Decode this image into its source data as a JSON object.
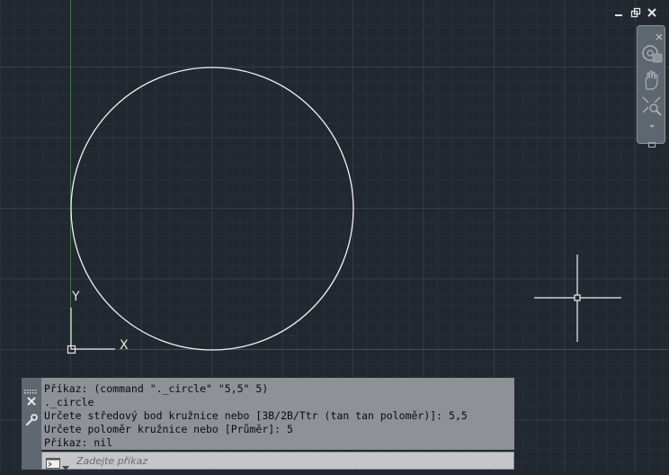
{
  "colors": {
    "background": "#212830",
    "grid_minor": "#27303a",
    "grid_major": "#313b47",
    "y_axis": "#3f7a3a",
    "x_axis": "#7a3a3a",
    "circle": "#ffffff"
  },
  "drawing": {
    "circle": {
      "center": [
        5,
        5
      ],
      "radius": 5
    }
  },
  "ucs": {
    "x_label": "X",
    "y_label": "Y"
  },
  "window_controls": {
    "minimize_icon": "minimize-icon",
    "restore_icon": "restore-icon",
    "close_icon": "close-icon"
  },
  "navbar": {
    "close_icon": "close-icon",
    "items": [
      "steering-wheel-icon",
      "pan-hand-icon",
      "zoom-extents-icon",
      "chevron-down-icon"
    ]
  },
  "command_line": {
    "history": [
      "Příkaz: (command \"._circle\" \"5,5\" 5)",
      "._circle",
      "Určete středový bod kružnice nebo [3B/2B/Ttr (tan tan poloměr)]: 5,5",
      "Určete poloměr kružnice nebo [Průměr]: 5",
      "Příkaz: nil"
    ],
    "placeholder": "Zadejte příkaz"
  }
}
